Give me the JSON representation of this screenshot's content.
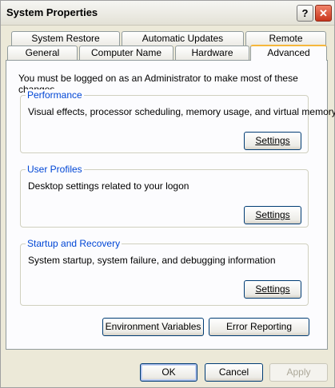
{
  "window": {
    "title": "System Properties",
    "help_glyph": "?",
    "close_glyph": "✕"
  },
  "tabs_row1": [
    {
      "label": "System Restore"
    },
    {
      "label": "Automatic Updates"
    },
    {
      "label": "Remote"
    }
  ],
  "tabs_row2": [
    {
      "label": "General"
    },
    {
      "label": "Computer Name"
    },
    {
      "label": "Hardware"
    },
    {
      "label": "Advanced",
      "active": true
    }
  ],
  "intro": "You must be logged on as an Administrator to make most of these changes.",
  "groups": {
    "performance": {
      "label": "Performance",
      "description": "Visual effects, processor scheduling, memory usage, and virtual memory",
      "button_label": "Settings"
    },
    "user_profiles": {
      "label": "User Profiles",
      "description": "Desktop settings related to your logon",
      "button_label": "Settings"
    },
    "startup_recovery": {
      "label": "Startup and Recovery",
      "description": "System startup, system failure, and debugging information",
      "button_label": "Settings"
    }
  },
  "buttons": {
    "environment_variables": "Environment Variables",
    "error_reporting": "Error Reporting",
    "ok": "OK",
    "cancel": "Cancel",
    "apply": "Apply"
  },
  "colors": {
    "active_tab_highlight": "#f6b73b",
    "group_label": "#0046d5",
    "close_button": "#c8351c"
  }
}
